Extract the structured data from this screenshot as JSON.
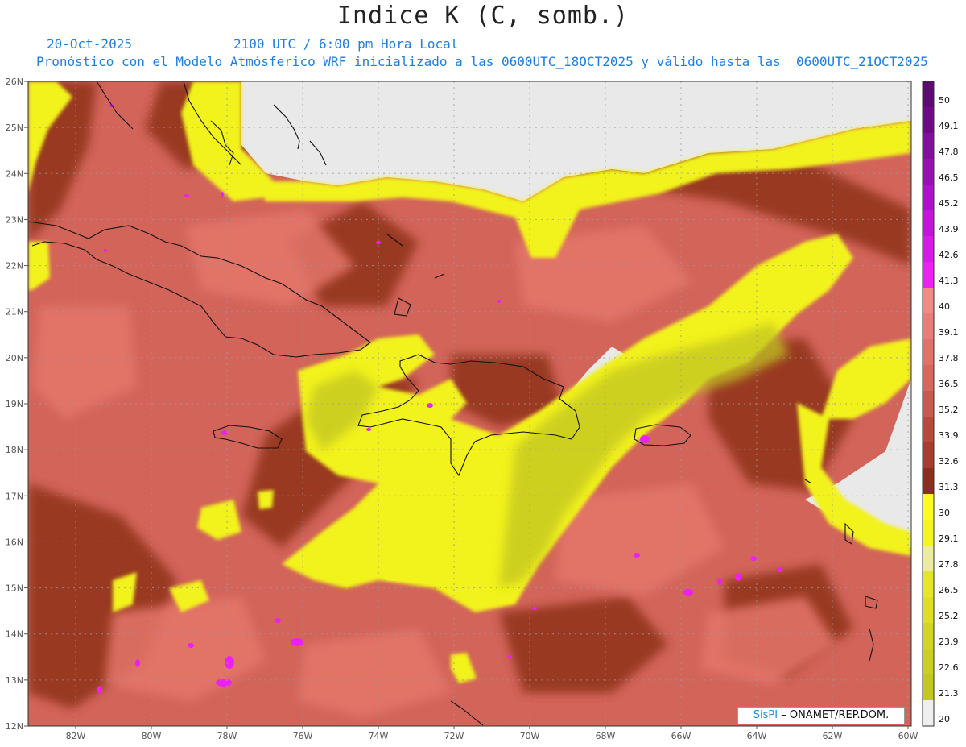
{
  "header": {
    "title": "Indice K (C, somb.)",
    "date": "20-Oct-2025",
    "time": "2100 UTC / 6:00 pm Hora Local",
    "description": "Pronóstico con el Modelo Atmósferico WRF inicializado a las 0600UTC_18OCT2025 y válido hasta las  0600UTC_21OCT2025"
  },
  "map": {
    "lat_labels": [
      "26N",
      "25N",
      "24N",
      "23N",
      "22N",
      "21N",
      "20N",
      "19N",
      "18N",
      "17N",
      "16N",
      "15N",
      "14N",
      "13N",
      "12N"
    ],
    "lon_labels": [
      "82W",
      "80W",
      "78W",
      "76W",
      "74W",
      "72W",
      "70W",
      "68W",
      "66W",
      "64W",
      "62W",
      "60W"
    ]
  },
  "colorbar": {
    "labels": [
      "50",
      "49.1",
      "47.8",
      "46.5",
      "45.2",
      "43.9",
      "42.6",
      "41.3",
      "40",
      "39.1",
      "37.8",
      "36.5",
      "35.2",
      "33.9",
      "32.6",
      "31.3",
      "30",
      "29.1",
      "27.8",
      "26.5",
      "25.2",
      "23.9",
      "22.6",
      "21.3",
      "20"
    ],
    "colors": [
      "#5e0a73",
      "#6e0a88",
      "#82109c",
      "#9810b4",
      "#b010cc",
      "#c414dc",
      "#d81ae8",
      "#ec20f6",
      "#f08a84",
      "#ea7e76",
      "#e2716a",
      "#d9665e",
      "#c95a4e",
      "#b84a3c",
      "#a83c2e",
      "#8c2e1c",
      "#fcfc20",
      "#f4f420",
      "#ececa0",
      "#e6e628",
      "#dede24",
      "#d2d622",
      "#cacf22",
      "#c2c822",
      "#eeeeee"
    ]
  },
  "credit": {
    "brand": "SisPI",
    "text": " – ONAMET/REP.DOM."
  }
}
